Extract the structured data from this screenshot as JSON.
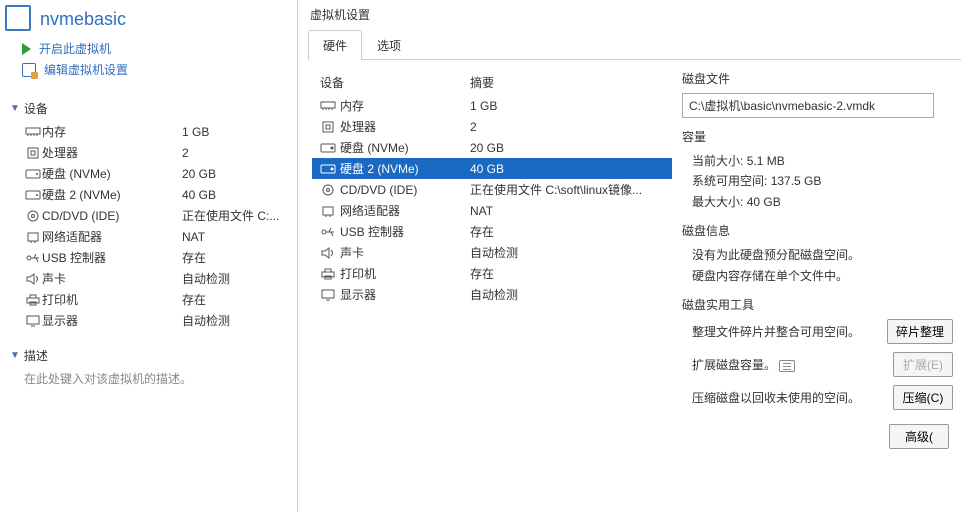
{
  "vm_name": "nvmebasic",
  "actions": {
    "power_on": "开启此虚拟机",
    "edit_settings": "编辑虚拟机设置"
  },
  "left": {
    "devices_header": "设备",
    "desc_header": "描述",
    "desc_placeholder": "在此处键入对该虚拟机的描述。",
    "devices": [
      {
        "icon": "memory",
        "name": "内存",
        "summary": "1 GB"
      },
      {
        "icon": "cpu",
        "name": "处理器",
        "summary": "2"
      },
      {
        "icon": "disk",
        "name": "硬盘 (NVMe)",
        "summary": "20 GB"
      },
      {
        "icon": "disk",
        "name": "硬盘 2 (NVMe)",
        "summary": "40 GB"
      },
      {
        "icon": "cd",
        "name": "CD/DVD (IDE)",
        "summary": "正在使用文件 C:..."
      },
      {
        "icon": "net",
        "name": "网络适配器",
        "summary": "NAT"
      },
      {
        "icon": "usb",
        "name": "USB 控制器",
        "summary": "存在"
      },
      {
        "icon": "sound",
        "name": "声卡",
        "summary": "自动检测"
      },
      {
        "icon": "printer",
        "name": "打印机",
        "summary": "存在"
      },
      {
        "icon": "display",
        "name": "显示器",
        "summary": "自动检测"
      }
    ]
  },
  "dialog": {
    "title": "虚拟机设置",
    "tabs": {
      "hardware": "硬件",
      "options": "选项"
    },
    "col_device": "设备",
    "col_summary": "摘要",
    "rows": [
      {
        "icon": "memory",
        "name": "内存",
        "summary": "1 GB",
        "selected": false
      },
      {
        "icon": "cpu",
        "name": "处理器",
        "summary": "2",
        "selected": false
      },
      {
        "icon": "disk",
        "name": "硬盘 (NVMe)",
        "summary": "20 GB",
        "selected": false
      },
      {
        "icon": "disk",
        "name": "硬盘 2 (NVMe)",
        "summary": "40 GB",
        "selected": true
      },
      {
        "icon": "cd",
        "name": "CD/DVD (IDE)",
        "summary": "正在使用文件 C:\\soft\\linux镜像...",
        "selected": false
      },
      {
        "icon": "net",
        "name": "网络适配器",
        "summary": "NAT",
        "selected": false
      },
      {
        "icon": "usb",
        "name": "USB 控制器",
        "summary": "存在",
        "selected": false
      },
      {
        "icon": "sound",
        "name": "声卡",
        "summary": "自动检测",
        "selected": false
      },
      {
        "icon": "printer",
        "name": "打印机",
        "summary": "存在",
        "selected": false
      },
      {
        "icon": "display",
        "name": "显示器",
        "summary": "自动检测",
        "selected": false
      }
    ],
    "disk_file": {
      "label": "磁盘文件",
      "path": "C:\\虚拟机\\basic\\nvmebasic-2.vmdk"
    },
    "capacity": {
      "label": "容量",
      "current_label": "当前大小:",
      "current_value": "5.1 MB",
      "free_label": "系统可用空间:",
      "free_value": "137.5 GB",
      "max_label": "最大大小:",
      "max_value": "40 GB"
    },
    "disk_info": {
      "label": "磁盘信息",
      "line1": "没有为此硬盘预分配磁盘空间。",
      "line2": "硬盘内容存储在单个文件中。"
    },
    "utilities": {
      "label": "磁盘实用工具",
      "defrag_text": "整理文件碎片并整合可用空间。",
      "defrag_btn": "碎片整理",
      "expand_text": "扩展磁盘容量。",
      "expand_btn": "扩展(E)",
      "compact_text": "压缩磁盘以回收未使用的空间。",
      "compact_btn": "压缩(C)",
      "advanced_btn": "高级("
    }
  }
}
